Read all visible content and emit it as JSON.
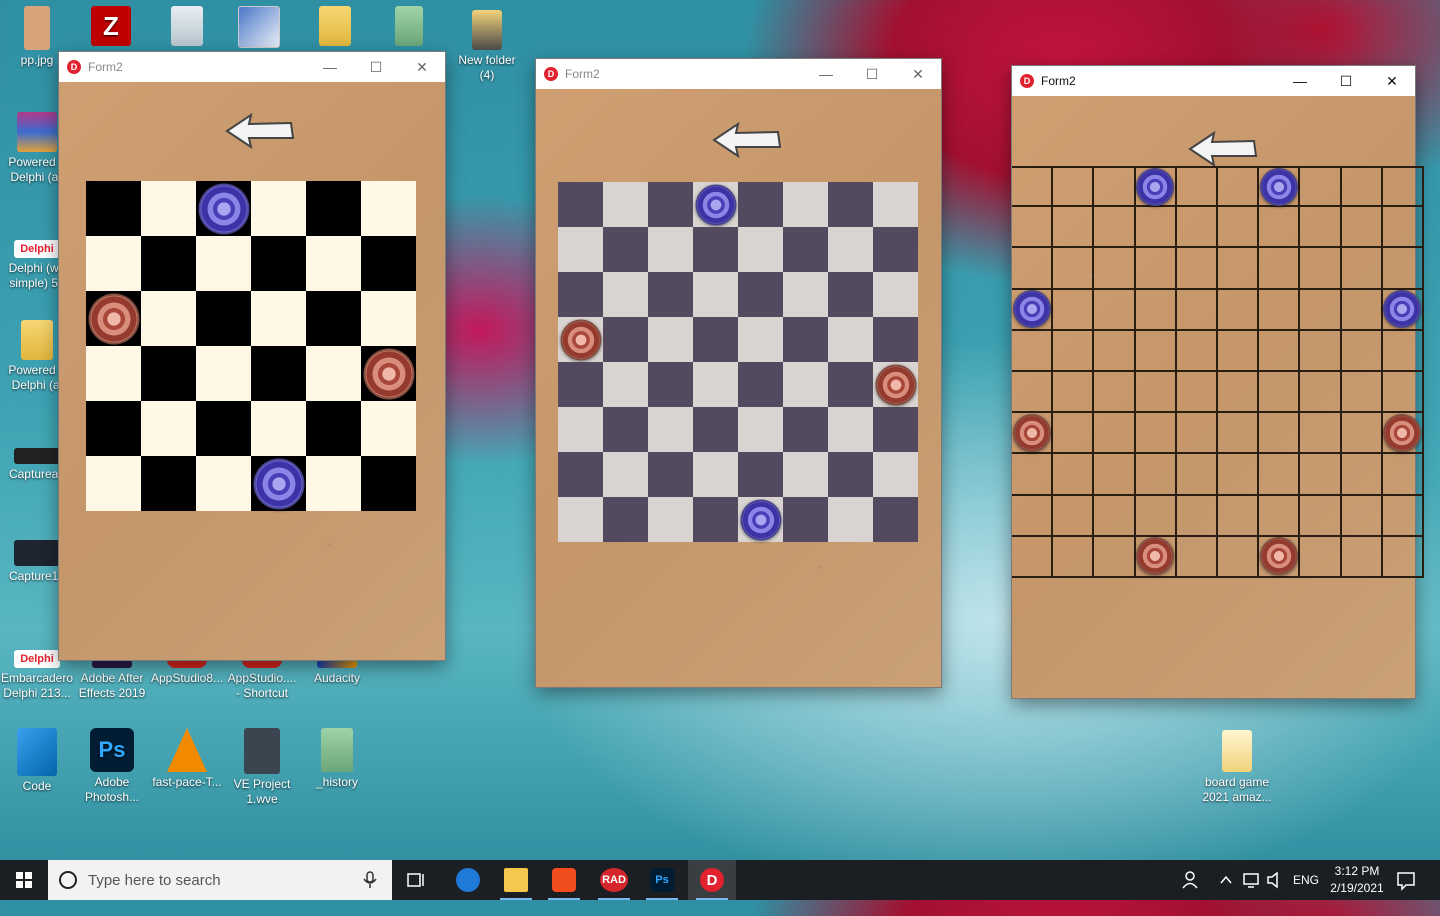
{
  "desktop_icons": [
    {
      "label": "pp.jpg",
      "icon": "image-file-icon"
    },
    {
      "label": "",
      "icon": "filezilla-icon"
    },
    {
      "label": "",
      "icon": "recycle-bin-icon"
    },
    {
      "label": "",
      "icon": "document-icon"
    },
    {
      "label": "",
      "icon": "folder-icon"
    },
    {
      "label": "",
      "icon": "folder-icon"
    },
    {
      "label": "New folder\n(4)",
      "icon": "folder-icon"
    },
    {
      "label": "Powered b\nDelphi (all",
      "icon": "winrar-icon"
    },
    {
      "label": "Delphi (wh\nsimple) 50",
      "icon": "delphi-icon"
    },
    {
      "label": "Powered b\nDelphi (al",
      "icon": "delphi-folder-icon"
    },
    {
      "label": "Captureaa",
      "icon": "image-file-icon"
    },
    {
      "label": "Capture12",
      "icon": "image-file-icon"
    },
    {
      "label": "Embarcadero\nDelphi 213...",
      "icon": "delphi-icon"
    },
    {
      "label": "Adobe After\nEffects 2019",
      "icon": "after-effects-icon"
    },
    {
      "label": "AppStudio8...",
      "icon": "app-icon"
    },
    {
      "label": "AppStudio....\n- Shortcut",
      "icon": "app-icon"
    },
    {
      "label": "Audacity",
      "icon": "audacity-icon"
    },
    {
      "label": "Code",
      "icon": "vscode-icon"
    },
    {
      "label": "Adobe\nPhotosh...",
      "icon": "photoshop-icon"
    },
    {
      "label": "fast-pace-T...",
      "icon": "vlc-icon"
    },
    {
      "label": "VE Project\n1.wve",
      "icon": "video-project-icon"
    },
    {
      "label": "_history",
      "icon": "folder-icon"
    },
    {
      "label": "board game\n2021 amaz...",
      "icon": "folder-icon"
    }
  ],
  "windows": [
    {
      "title": "Form2",
      "active": false,
      "controls": {
        "minimize": "—",
        "maximize": "☐",
        "close": "✕"
      }
    },
    {
      "title": "Form2",
      "active": false,
      "controls": {
        "minimize": "—",
        "maximize": "☐",
        "close": "✕"
      }
    },
    {
      "title": "Form2",
      "active": true,
      "controls": {
        "minimize": "—",
        "maximize": "☐",
        "close": "✕"
      }
    }
  ],
  "boards": [
    {
      "rows": 6,
      "cols": 6,
      "style": "black-cream",
      "colors": {
        "dark": "#000000",
        "light": "#fff8e6"
      },
      "pieces": [
        {
          "row": 0,
          "col": 2,
          "color": "blue"
        },
        {
          "row": 2,
          "col": 0,
          "color": "red"
        },
        {
          "row": 3,
          "col": 5,
          "color": "red"
        },
        {
          "row": 5,
          "col": 3,
          "color": "blue"
        }
      ]
    },
    {
      "rows": 8,
      "cols": 8,
      "style": "purple-grey",
      "colors": {
        "dark": "#544a60",
        "light": "#d9d3d2"
      },
      "pieces": [
        {
          "row": 0,
          "col": 3,
          "color": "blue"
        },
        {
          "row": 3,
          "col": 0,
          "color": "red"
        },
        {
          "row": 4,
          "col": 7,
          "color": "red"
        },
        {
          "row": 7,
          "col": 4,
          "color": "blue"
        }
      ]
    },
    {
      "rows": 10,
      "cols": 10,
      "style": "grid-lines",
      "colors": {
        "line": "#2a1d12"
      },
      "pieces": [
        {
          "row": 0,
          "col": 3,
          "color": "blue"
        },
        {
          "row": 0,
          "col": 6,
          "color": "blue"
        },
        {
          "row": 3,
          "col": 0,
          "color": "blue"
        },
        {
          "row": 3,
          "col": 9,
          "color": "blue"
        },
        {
          "row": 6,
          "col": 0,
          "color": "red"
        },
        {
          "row": 6,
          "col": 9,
          "color": "red"
        },
        {
          "row": 9,
          "col": 3,
          "color": "red"
        },
        {
          "row": 9,
          "col": 6,
          "color": "red"
        }
      ]
    }
  ],
  "taskbar": {
    "search_placeholder": "Type here to search",
    "pinned": [
      {
        "name": "task-view",
        "icon": "task-view-icon",
        "label": ""
      },
      {
        "name": "edge",
        "icon": "edge-icon",
        "label": ""
      },
      {
        "name": "file-explorer",
        "icon": "folder-icon",
        "label": ""
      },
      {
        "name": "brave",
        "icon": "brave-icon",
        "label": ""
      },
      {
        "name": "rad-studio",
        "icon": "rad-icon",
        "label": "RAD"
      },
      {
        "name": "photoshop",
        "icon": "photoshop-icon",
        "label": "Ps"
      },
      {
        "name": "delphi-app",
        "icon": "delphi-icon",
        "label": "D"
      }
    ],
    "language": "ENG",
    "time": "3:12 PM",
    "date": "2/19/2021"
  }
}
